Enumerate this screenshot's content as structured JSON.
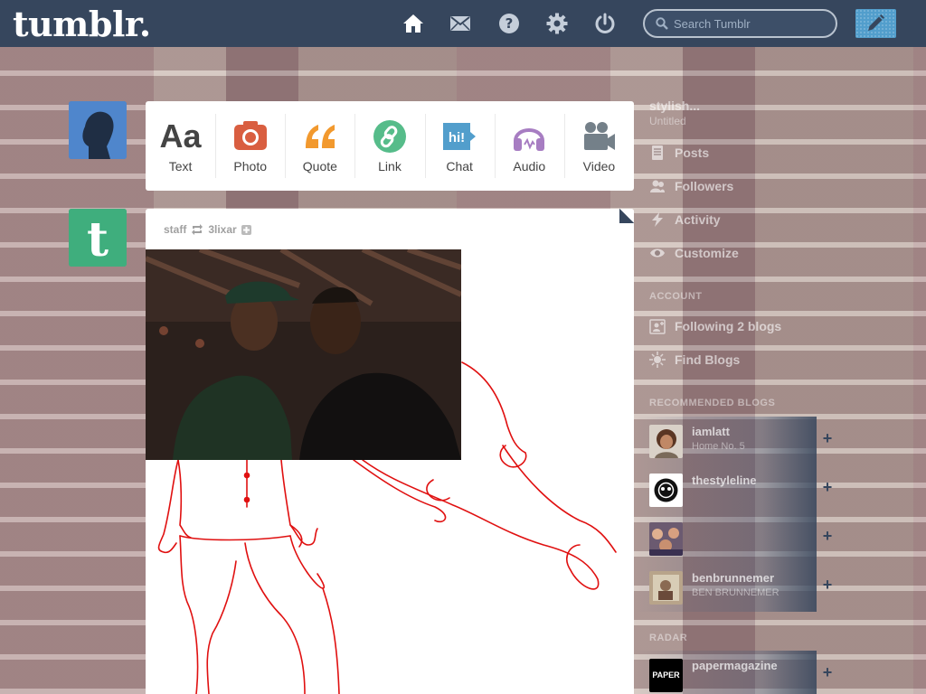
{
  "app": {
    "logo": "tumblr.",
    "search_placeholder": "Search Tumblr"
  },
  "nav": [
    {
      "name": "home-icon"
    },
    {
      "name": "mail-icon"
    },
    {
      "name": "help-icon"
    },
    {
      "name": "gear-icon"
    },
    {
      "name": "power-icon"
    }
  ],
  "post_types": [
    {
      "label": "Text",
      "icon": "text-icon",
      "color": "#444444"
    },
    {
      "label": "Photo",
      "icon": "camera-icon",
      "color": "#d95e40"
    },
    {
      "label": "Quote",
      "icon": "quote-icon",
      "color": "#f2992e"
    },
    {
      "label": "Link",
      "icon": "link-icon",
      "color": "#56bc8a"
    },
    {
      "label": "Chat",
      "icon": "chat-icon",
      "color": "#529ecc"
    },
    {
      "label": "Audio",
      "icon": "headphones-icon",
      "color": "#a77dc2"
    },
    {
      "label": "Video",
      "icon": "video-camera-icon",
      "color": "#748089"
    }
  ],
  "post": {
    "author": "staff",
    "reblogged_from": "3lixar"
  },
  "sidebar": {
    "blog_name": "stylish...",
    "blog_title": "Untitled",
    "items": [
      {
        "label": "Posts",
        "icon": "document-icon"
      },
      {
        "label": "Followers",
        "icon": "people-icon"
      },
      {
        "label": "Activity",
        "icon": "lightning-icon"
      },
      {
        "label": "Customize",
        "icon": "eye-icon"
      }
    ],
    "account_heading": "ACCOUNT",
    "account_items": [
      {
        "label": "Following 2 blogs",
        "icon": "person-plus-icon"
      },
      {
        "label": "Find Blogs",
        "icon": "compass-icon"
      }
    ],
    "recommended_heading": "RECOMMENDED BLOGS",
    "recommended": [
      {
        "name": "iamlatt",
        "title": "Home No. 5"
      },
      {
        "name": "thestyleline",
        "title": ""
      },
      {
        "name": "",
        "title": ""
      },
      {
        "name": "benbrunnemer",
        "title": "BEN BRUNNEMER"
      }
    ],
    "radar_heading": "RADAR",
    "radar": {
      "name": "papermagazine",
      "avatar_text": "PAPER"
    }
  },
  "colors": {
    "header_bg": "#36465d",
    "compose_bg": "#529ecc",
    "drawing_stroke": "#e01010"
  }
}
